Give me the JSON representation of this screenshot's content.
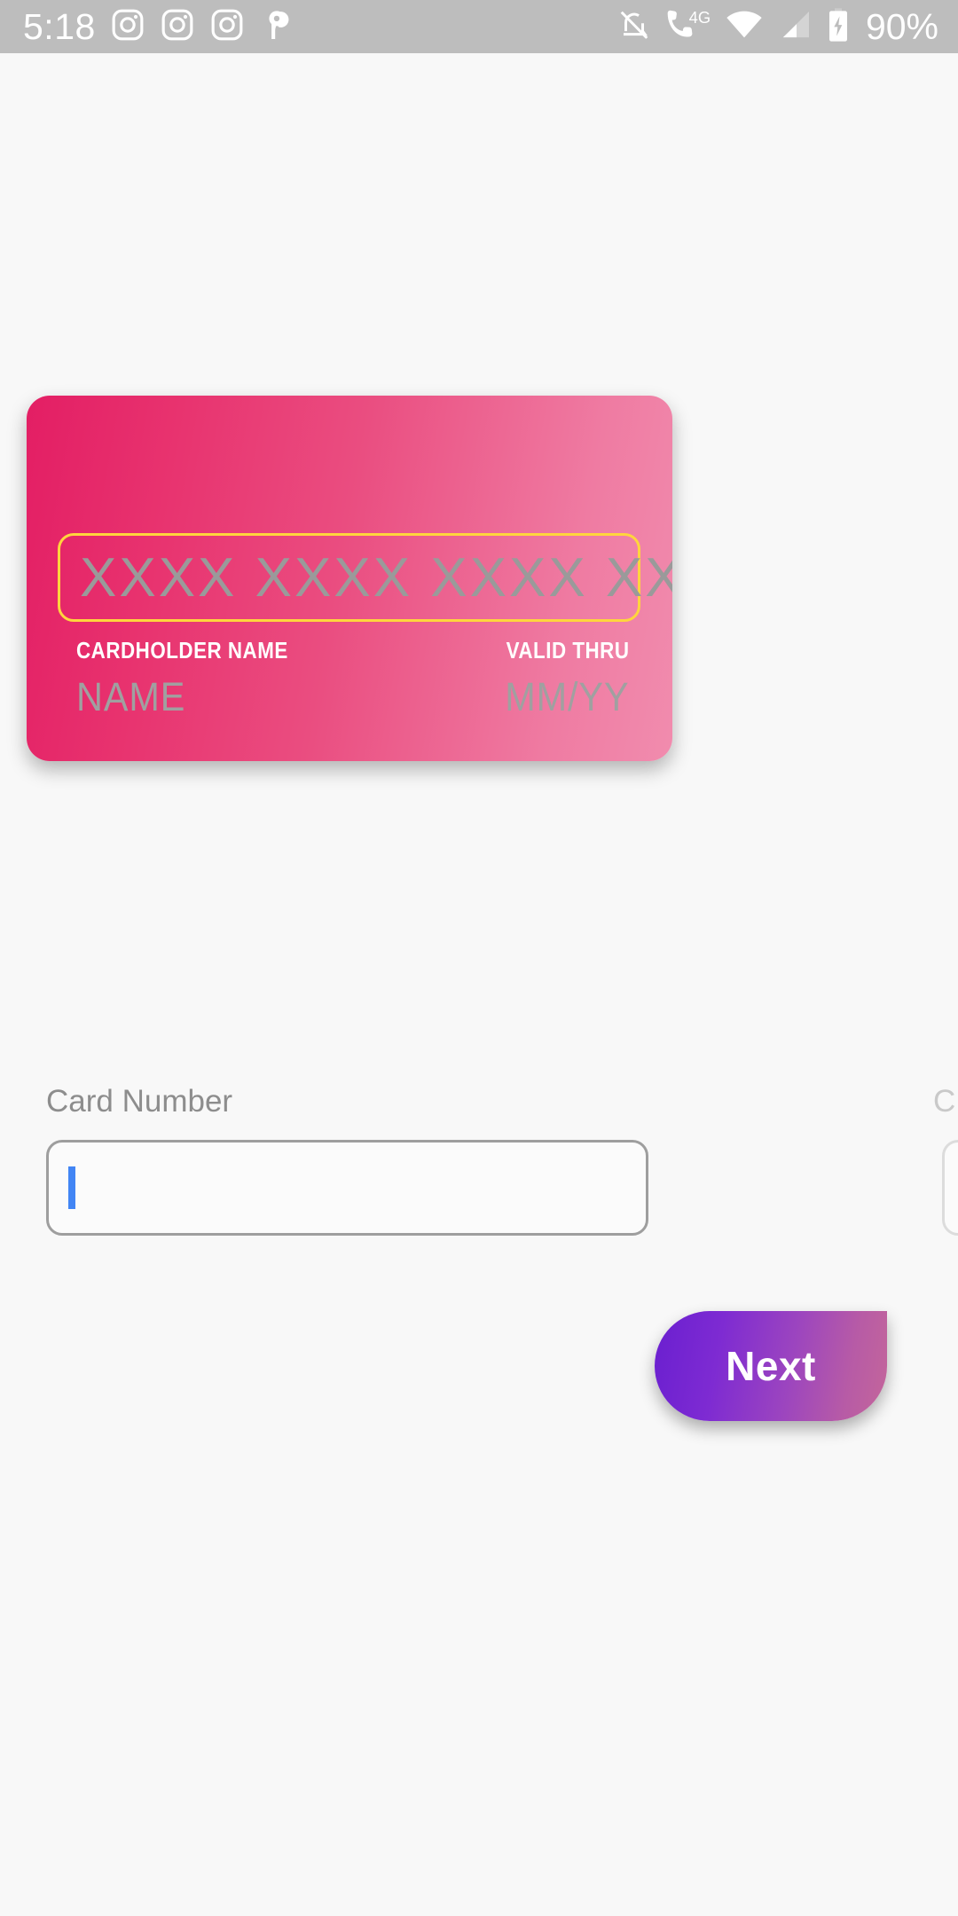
{
  "statusbar": {
    "time": "5:18",
    "battery_percent": "90%",
    "left_icons": [
      {
        "name": "instagram-icon"
      },
      {
        "name": "instagram-icon"
      },
      {
        "name": "instagram-icon"
      },
      {
        "name": "pinterest-icon"
      }
    ],
    "right_icons": [
      {
        "name": "notifications-off-icon"
      },
      {
        "name": "mobile-data-4g-icon",
        "label": "4G"
      },
      {
        "name": "wifi-icon"
      },
      {
        "name": "cellular-signal-icon"
      },
      {
        "name": "battery-charging-icon"
      }
    ],
    "background_color": "#bdbdbd",
    "foreground_color": "#ffffff"
  },
  "card": {
    "number_placeholder": "XXXX XXXX XXXX XXXX",
    "cardholder_label": "CARDHOLDER NAME",
    "valid_thru_label": "VALID THRU",
    "name_placeholder": "NAME",
    "expiry_placeholder": "MM/YY",
    "gradient_from": "#e31e64",
    "gradient_to": "#f18cae",
    "highlight_color": "#ffd53d",
    "placeholder_color": "#9a9a9a"
  },
  "form": {
    "card_number_label": "Card Number",
    "card_number_value": "",
    "next_field_label": "C",
    "caret_color": "#4285f4",
    "input_border_color": "#9e9e9e"
  },
  "actions": {
    "next_label": "Next",
    "next_gradient_from": "#6a1fd0",
    "next_gradient_to": "#c4669a"
  },
  "page": {
    "background_color": "#f8f8f8"
  }
}
